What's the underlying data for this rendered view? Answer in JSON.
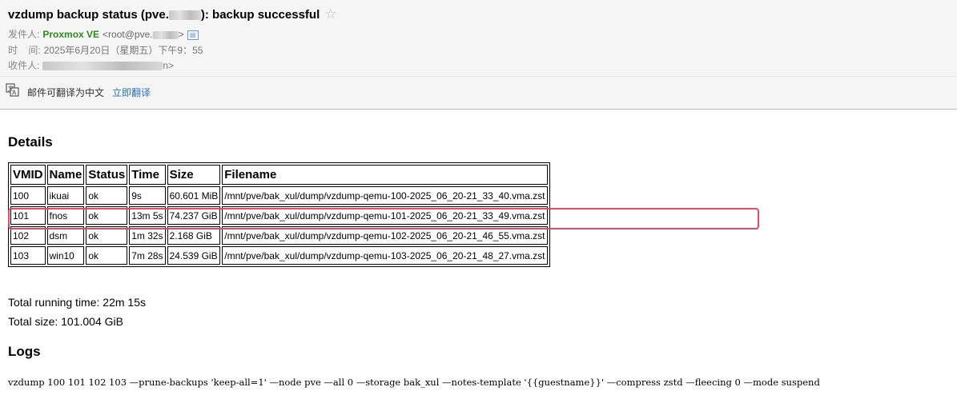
{
  "email": {
    "subject_prefix": "vzdump backup status (pve.",
    "subject_suffix": "): backup successful",
    "star": "☆",
    "from_label": "发件人:",
    "from_name": "Proxmox VE",
    "from_addr_prefix": "<root@pve.",
    "from_addr_suffix": ">",
    "time_label": "时    间:",
    "time_value": "2025年6月20日（星期五）下午9：55",
    "to_label": "收件人:",
    "to_suffix": "n>"
  },
  "translate": {
    "text": "邮件可翻译为中文",
    "link": "立即翻译"
  },
  "details": {
    "heading": "Details",
    "columns": [
      "VMID",
      "Name",
      "Status",
      "Time",
      "Size",
      "Filename"
    ],
    "rows": [
      {
        "vmid": "100",
        "name": "ikuai",
        "status": "ok",
        "time": "9s",
        "size": "60.601 MiB",
        "filename": "/mnt/pve/bak_xul/dump/vzdump-qemu-100-2025_06_20-21_33_40.vma.zst"
      },
      {
        "vmid": "101",
        "name": "fnos",
        "status": "ok",
        "time": "13m 5s",
        "size": "74.237 GiB",
        "filename": "/mnt/pve/bak_xul/dump/vzdump-qemu-101-2025_06_20-21_33_49.vma.zst"
      },
      {
        "vmid": "102",
        "name": "dsm",
        "status": "ok",
        "time": "1m 32s",
        "size": "2.168 GiB",
        "filename": "/mnt/pve/bak_xul/dump/vzdump-qemu-102-2025_06_20-21_46_55.vma.zst"
      },
      {
        "vmid": "103",
        "name": "win10",
        "status": "ok",
        "time": "7m 28s",
        "size": "24.539 GiB",
        "filename": "/mnt/pve/bak_xul/dump/vzdump-qemu-103-2025_06_20-21_48_27.vma.zst"
      }
    ]
  },
  "summary": {
    "total_time": "Total running time: 22m 15s",
    "total_size": "Total size: 101.004 GiB"
  },
  "logs": {
    "heading": "Logs",
    "command": "vzdump 100 101 102 103 —prune-backups 'keep-all=1' —node pve —all 0 —storage bak_xul —notes-template '{{guestname}}' —compress zstd —fleecing 0 —mode suspend"
  },
  "colors": {
    "sender": "#2e8b1a",
    "link": "#2a6fc9",
    "highlight": "#e8485f"
  }
}
